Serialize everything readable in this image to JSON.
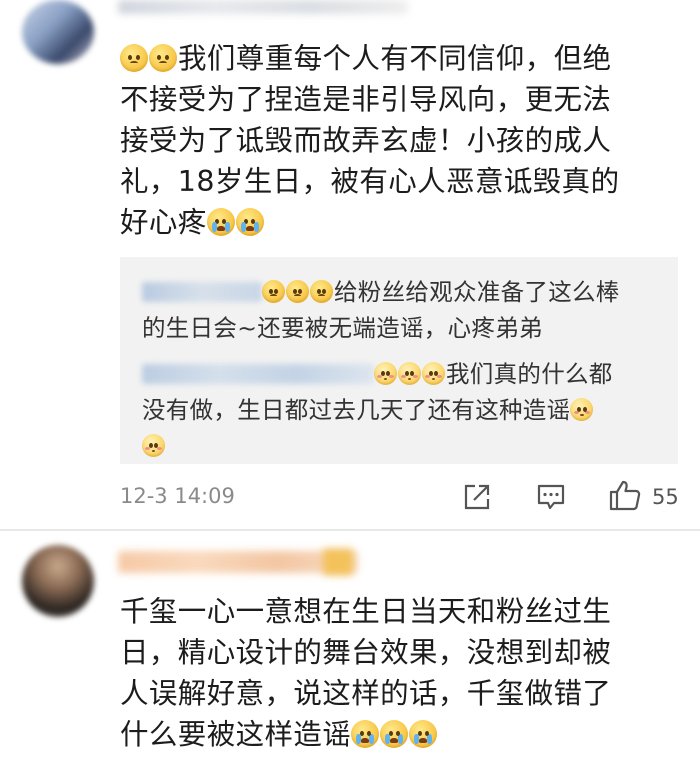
{
  "comment1": {
    "text_line1": "我们尊重每个人有不同信仰，但绝",
    "text_line2": "不接受为了捏造是非引导风向，更无法",
    "text_line3": "接受为了诋毁而故弄玄虚！小孩的成人",
    "text_line4": "礼，18岁生日，被有心人恶意诋毁真的",
    "text_line5": "好心疼",
    "replies": [
      {
        "line1": "给粉丝给观众准备了这么棒",
        "line2": "的生日会~还要被无端造谣，心疼弟弟"
      },
      {
        "line1": "我们真的什么都",
        "line2": "没有做，生日都过去几天了还有这种造谣"
      }
    ],
    "timestamp": "12-3 14:09",
    "like_count": "55"
  },
  "comment2": {
    "text_line1": "千玺一心一意想在生日当天和粉丝过生",
    "text_line2": "日，精心设计的舞台效果，没想到却被",
    "text_line3": "人误解好意，说这样的话，千玺做错了",
    "text_line4": "什么要被这样造谣"
  },
  "colors": {
    "background": "#ffffff",
    "reply_background": "#f2f2f2",
    "timestamp": "#8a8a8a",
    "divider": "#e8e8e8",
    "emoji_yellow": "#f7c84a",
    "tear_blue": "#5fb3ef"
  },
  "icons": [
    "sad-emoji-icon",
    "crying-emoji-icon",
    "shy-emoji-icon",
    "share-icon",
    "comment-icon",
    "like-icon"
  ]
}
